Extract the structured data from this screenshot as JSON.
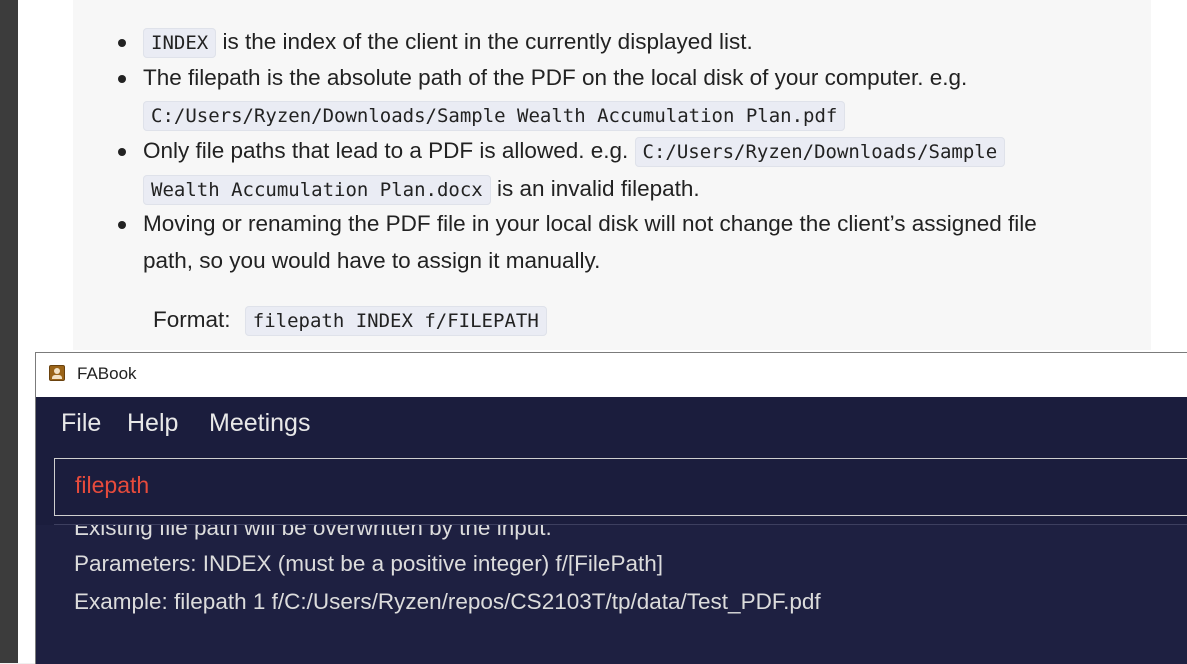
{
  "doc": {
    "bullets": [
      {
        "code": "INDEX",
        "text": "is the index of the client in the currently displayed list."
      },
      {
        "text_line1": "The filepath is the absolute path of the PDF on the local disk of your computer. e.g.",
        "code": "C:/Users/Ryzen/Downloads/Sample Wealth Accumulation Plan.pdf"
      },
      {
        "text": "Only file paths that lead to a PDF is allowed. e.g.",
        "code_part1": "C:/Users/Ryzen/Downloads/Sample",
        "code_part2": "Wealth Accumulation Plan.docx",
        "text_after": "is an invalid filepath."
      },
      {
        "text_line1": "Moving or renaming the PDF file in your local disk will not change the client’s assigned file",
        "text_line2": "path, so you would have to assign it manually."
      }
    ],
    "format_label": "Format:",
    "format_code": "filepath INDEX f/FILEPATH"
  },
  "app": {
    "title": "FABook",
    "menu": [
      "File",
      "Help",
      "Meetings"
    ],
    "command_value": "filepath",
    "result_lines": [
      "Existing file path will be overwritten by the input.",
      "Parameters: INDEX (must be a positive integer) f/[FilePath]",
      "Example: filepath 1 f/C:/Users/Ryzen/repos/CS2103T/tp/data/Test_PDF.pdf"
    ]
  },
  "colors": {
    "window_bg": "#1b1d3d",
    "command_text": "#e74b3c",
    "result_text": "#dcdcdc",
    "code_bg": "#eaecf4"
  }
}
